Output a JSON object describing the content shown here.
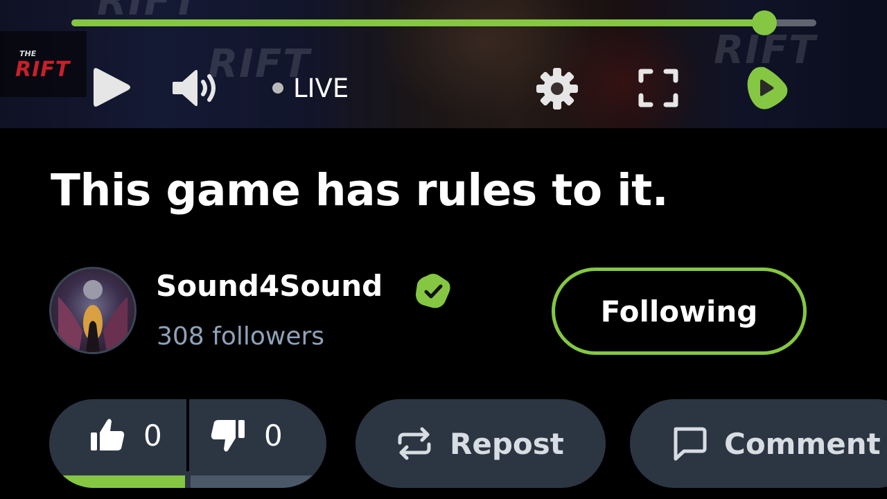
{
  "player": {
    "brand_watermark": "RIFT",
    "logo": {
      "top": "THE",
      "main": "RIFT"
    },
    "progress": 0.93,
    "live_label": "LIVE",
    "accent_color": "#85c742",
    "icons": {
      "play": "play-icon",
      "volume": "volume-icon",
      "settings": "gear-icon",
      "fullscreen": "fullscreen-icon",
      "rumble": "rumble-logo-icon"
    }
  },
  "video": {
    "title": "This game has rules to it."
  },
  "channel": {
    "name": "Sound4Sound",
    "verified": true,
    "followers": "308 followers",
    "follow_button": "Following"
  },
  "actions": {
    "likes": "0",
    "dislikes": "0",
    "like_ratio": 0.5,
    "repost_label": "Repost",
    "comment_label": "Comment"
  }
}
